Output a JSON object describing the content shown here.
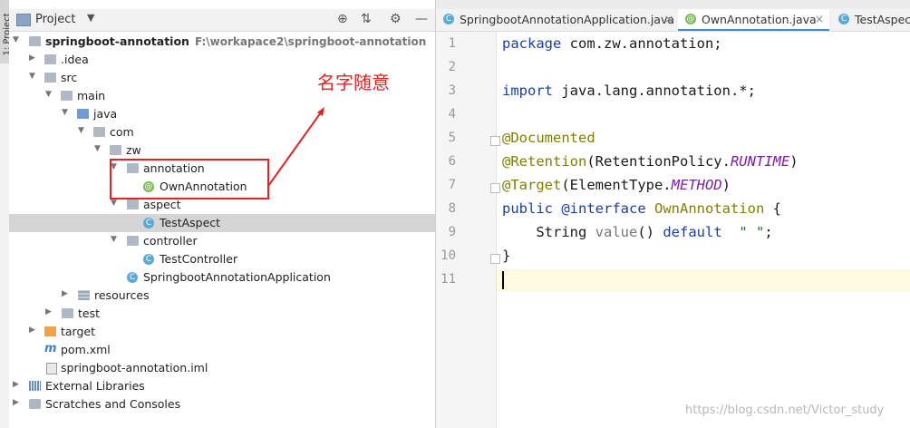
{
  "project_panel": {
    "title": "Project",
    "tree": [
      {
        "label": "springboot-annotation",
        "path": "F:\\workapace2\\springboot-annotation",
        "icon": "module-icon"
      },
      {
        "label": ".idea",
        "icon": "folder-icon"
      },
      {
        "label": "src",
        "icon": "folder-icon"
      },
      {
        "label": "main",
        "icon": "folder-icon"
      },
      {
        "label": "java",
        "icon": "source-folder-icon"
      },
      {
        "label": "com",
        "icon": "package-icon"
      },
      {
        "label": "zw",
        "icon": "package-icon"
      },
      {
        "label": "annotation",
        "icon": "package-icon"
      },
      {
        "label": "OwnAnnotation",
        "icon": "annotation-icon"
      },
      {
        "label": "aspect",
        "icon": "package-icon"
      },
      {
        "label": "TestAspect",
        "icon": "class-icon"
      },
      {
        "label": "controller",
        "icon": "package-icon"
      },
      {
        "label": "TestController",
        "icon": "class-icon"
      },
      {
        "label": "SpringbootAnnotationApplication",
        "icon": "spring-class-icon"
      },
      {
        "label": "resources",
        "icon": "resources-folder-icon"
      },
      {
        "label": "test",
        "icon": "folder-icon"
      },
      {
        "label": "target",
        "icon": "excluded-folder-icon"
      },
      {
        "label": "pom.xml",
        "icon": "maven-icon"
      },
      {
        "label": "springboot-annotation.iml",
        "icon": "iml-file-icon"
      },
      {
        "label": "External Libraries",
        "icon": "libraries-icon"
      },
      {
        "label": "Scratches and Consoles",
        "icon": "scratches-icon"
      }
    ]
  },
  "side_tab": "1: Project",
  "annotation_note": "名字随意",
  "tabs": [
    {
      "label": "SpringbootAnnotationApplication.java"
    },
    {
      "label": "OwnAnnotation.java"
    },
    {
      "label": "TestAspect"
    }
  ],
  "editor": {
    "line_numbers": [
      "1",
      "2",
      "3",
      "4",
      "5",
      "6",
      "7",
      "8",
      "9",
      "10",
      "11"
    ],
    "lines": {
      "l1_kw": "package",
      "l1_rest": " com.zw.annotation;",
      "l3_kw": "import",
      "l3_rest": " java.lang.annotation.*;",
      "l5": "@Documented",
      "l6_a": "@Retention",
      "l6_b": "(RetentionPolicy.",
      "l6_c": "RUNTIME",
      "l6_d": ")",
      "l7_a": "@Target",
      "l7_b": "(ElementType.",
      "l7_c": "METHOD",
      "l7_d": ")",
      "l8_kw": "public",
      "l8_kw2": " @interface",
      "l8_name": " OwnAnnotation",
      "l8_rest": " {",
      "l9_type": "    String ",
      "l9_name": "value",
      "l9_paren": "() ",
      "l9_kw": "default",
      "l9_str": "  \" \"",
      "l9_end": ";",
      "l10": "}"
    }
  },
  "watermark": "https://blog.csdn.net/Victor_study"
}
